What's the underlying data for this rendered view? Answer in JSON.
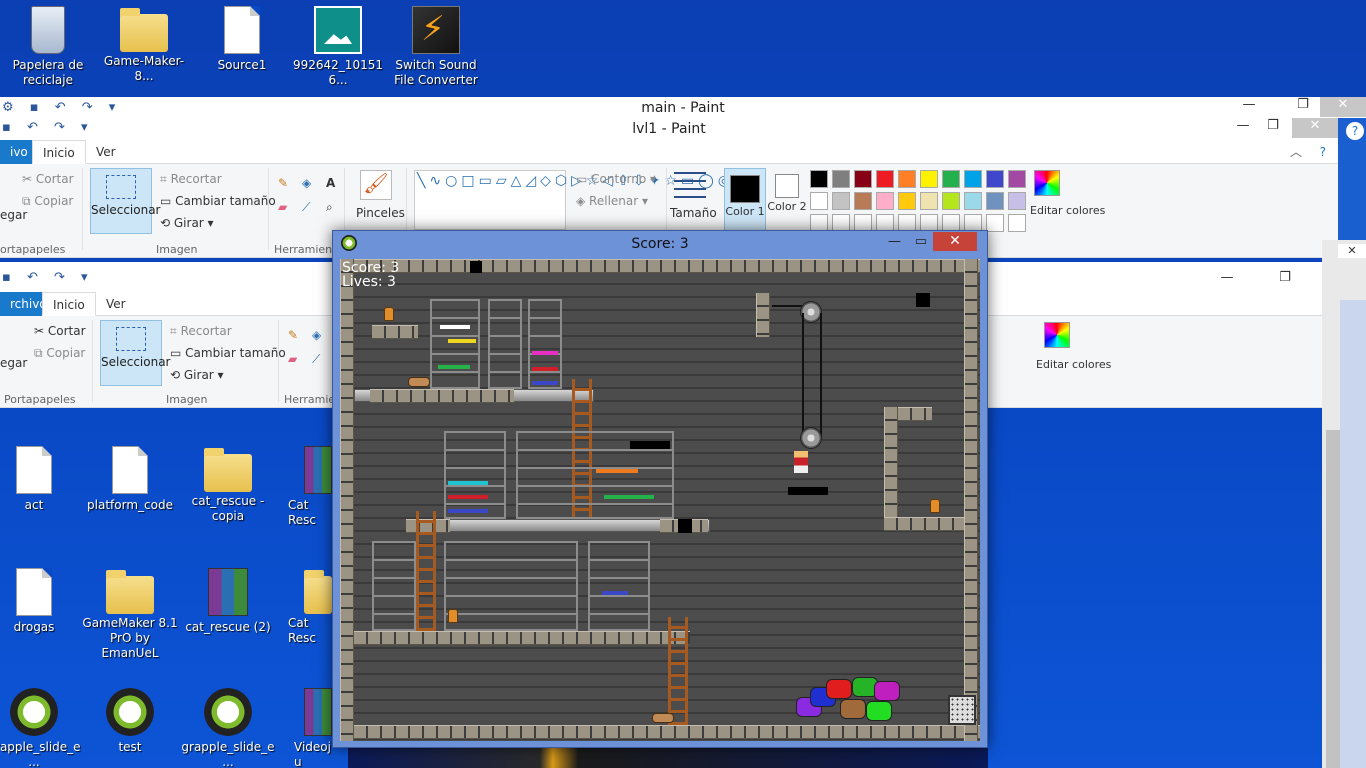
{
  "desktop_top": [
    {
      "label": "Papelera de reciclaje",
      "icon": "recycle-bin-icon"
    },
    {
      "label": "Game-Maker-8...",
      "icon": "folder-icon"
    },
    {
      "label": "Source1",
      "icon": "document-icon"
    },
    {
      "label": "992642_101516...",
      "icon": "photo-icon"
    },
    {
      "label": "Switch Sound File Converter",
      "icon": "sound-converter-icon"
    }
  ],
  "desktop_left": [
    {
      "label": "act",
      "icon": "document-icon"
    },
    {
      "label": "platform_code",
      "icon": "document-icon"
    },
    {
      "label": "cat_rescue - copia",
      "icon": "folder-icon"
    },
    {
      "label": "Cat Resc",
      "icon": "archive-icon"
    },
    {
      "label": "drogas",
      "icon": "document-icon"
    },
    {
      "label": "GameMaker 8.1 PrO by EmanUeL",
      "icon": "folder-icon"
    },
    {
      "label": "cat_rescue (2)",
      "icon": "archive-icon"
    },
    {
      "label": "Cat Resc",
      "icon": "folder-icon"
    },
    {
      "label": "grapple_slide_e...",
      "icon": "gamemaker-icon"
    },
    {
      "label": "test",
      "icon": "gamemaker-icon"
    },
    {
      "label": "grapple_slide_e...",
      "icon": "gamemaker-icon"
    },
    {
      "label": "Videoju",
      "icon": "archive-icon"
    }
  ],
  "paint_main": {
    "title": "main - Paint"
  },
  "paint_lvl1": {
    "title": "lvl1 - Paint",
    "tabs": {
      "file": "ivo",
      "home": "Inicio",
      "view": "Ver"
    },
    "clipboard": {
      "cut": "Cortar",
      "copy": "Copiar",
      "paste": "egar",
      "group": "ortapapeles"
    },
    "image": {
      "select": "Seleccionar",
      "crop": "Recortar",
      "resize": "Cambiar tamaño",
      "rotate": "Girar",
      "group": "Imagen"
    },
    "tools_group": "Herramien",
    "brushes": "Pinceles",
    "outline": "Contorno",
    "fill": "Rellenar",
    "size": "Tamaño",
    "color1": "Color 1",
    "color2": "Color 2",
    "edit_colors": "Editar colores"
  },
  "paint_back": {
    "tabs": {
      "file": "rchivo",
      "home": "Inicio",
      "view": "Ver"
    },
    "clipboard": {
      "cut": "Cortar",
      "copy": "Copiar",
      "paste": "egar",
      "group": "Portapapeles"
    },
    "image": {
      "select": "Seleccionar",
      "crop": "Recortar",
      "resize": "Cambiar tamaño",
      "rotate": "Girar",
      "group": "Imagen"
    },
    "tools_group": "Herramie",
    "edit_colors": "Editar colores"
  },
  "palette_row1": [
    "#000000",
    "#7f7f7f",
    "#880015",
    "#ed1c24",
    "#ff7f27",
    "#fff200",
    "#22b14c",
    "#00a2e8",
    "#3f48cc",
    "#a349a4"
  ],
  "palette_row2": [
    "#ffffff",
    "#c3c3c3",
    "#b97a57",
    "#ffaec9",
    "#ffc90e",
    "#efe4b0",
    "#b5e61d",
    "#99d9ea",
    "#7092be",
    "#c8bfe7"
  ],
  "game": {
    "title": "Score: 3",
    "hud_score": "Score: 3",
    "hud_lives": "Lives: 3",
    "score": 3,
    "lives": 3
  },
  "colors": {
    "desktop": "#0a49c6",
    "paint_file_tab": "#1979ca",
    "close_red": "#c6433a"
  }
}
